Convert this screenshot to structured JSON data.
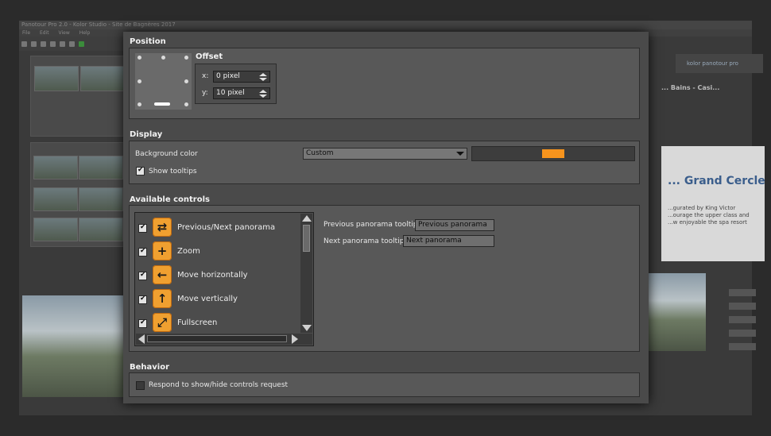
{
  "background_app": {
    "window_title": "Panotour Pro 2.0 - Kolor Studio - Site de Bagnères 2017",
    "menu": [
      "File",
      "Edit",
      "View",
      "Help"
    ],
    "header_label": "kolor panotour pro",
    "panel_title": "... Bains - Casi...",
    "doc_heading": "... Grand Cercle",
    "doc_text": "...gurated by King Victor ...ourage the upper class and ...w enjoyable the spa resort",
    "doc_link": "spa resort"
  },
  "position": {
    "title": "Position",
    "offset_title": "Offset",
    "x_label": "x:",
    "x_value": "0 pixel",
    "y_label": "y:",
    "y_value": "10 pixel"
  },
  "display": {
    "title": "Display",
    "bg_color_label": "Background color",
    "bg_color_option": "Custom",
    "bg_color_value": "#f7941d",
    "show_tooltips_label": "Show tooltips",
    "show_tooltips_checked": true
  },
  "available_controls": {
    "title": "Available controls",
    "items": [
      {
        "label": "Previous/Next panorama",
        "icon": "prev-next-icon",
        "glyph": "⇄",
        "checked": true
      },
      {
        "label": "Zoom",
        "icon": "zoom-icon",
        "glyph": "+",
        "checked": true
      },
      {
        "label": "Move horizontally",
        "icon": "move-horizontal-icon",
        "glyph": "←",
        "checked": true
      },
      {
        "label": "Move vertically",
        "icon": "move-vertical-icon",
        "glyph": "↑",
        "checked": true
      },
      {
        "label": "Fullscreen",
        "icon": "fullscreen-icon",
        "glyph": "⤢",
        "checked": true
      }
    ],
    "prev_tooltip_label": "Previous panorama tooltip",
    "prev_tooltip_value": "Previous panorama",
    "next_tooltip_label": "Next panorama tooltip",
    "next_tooltip_value": "Next panorama"
  },
  "behavior": {
    "title": "Behavior",
    "respond_label": "Respond to show/hide controls request",
    "respond_checked": false
  }
}
